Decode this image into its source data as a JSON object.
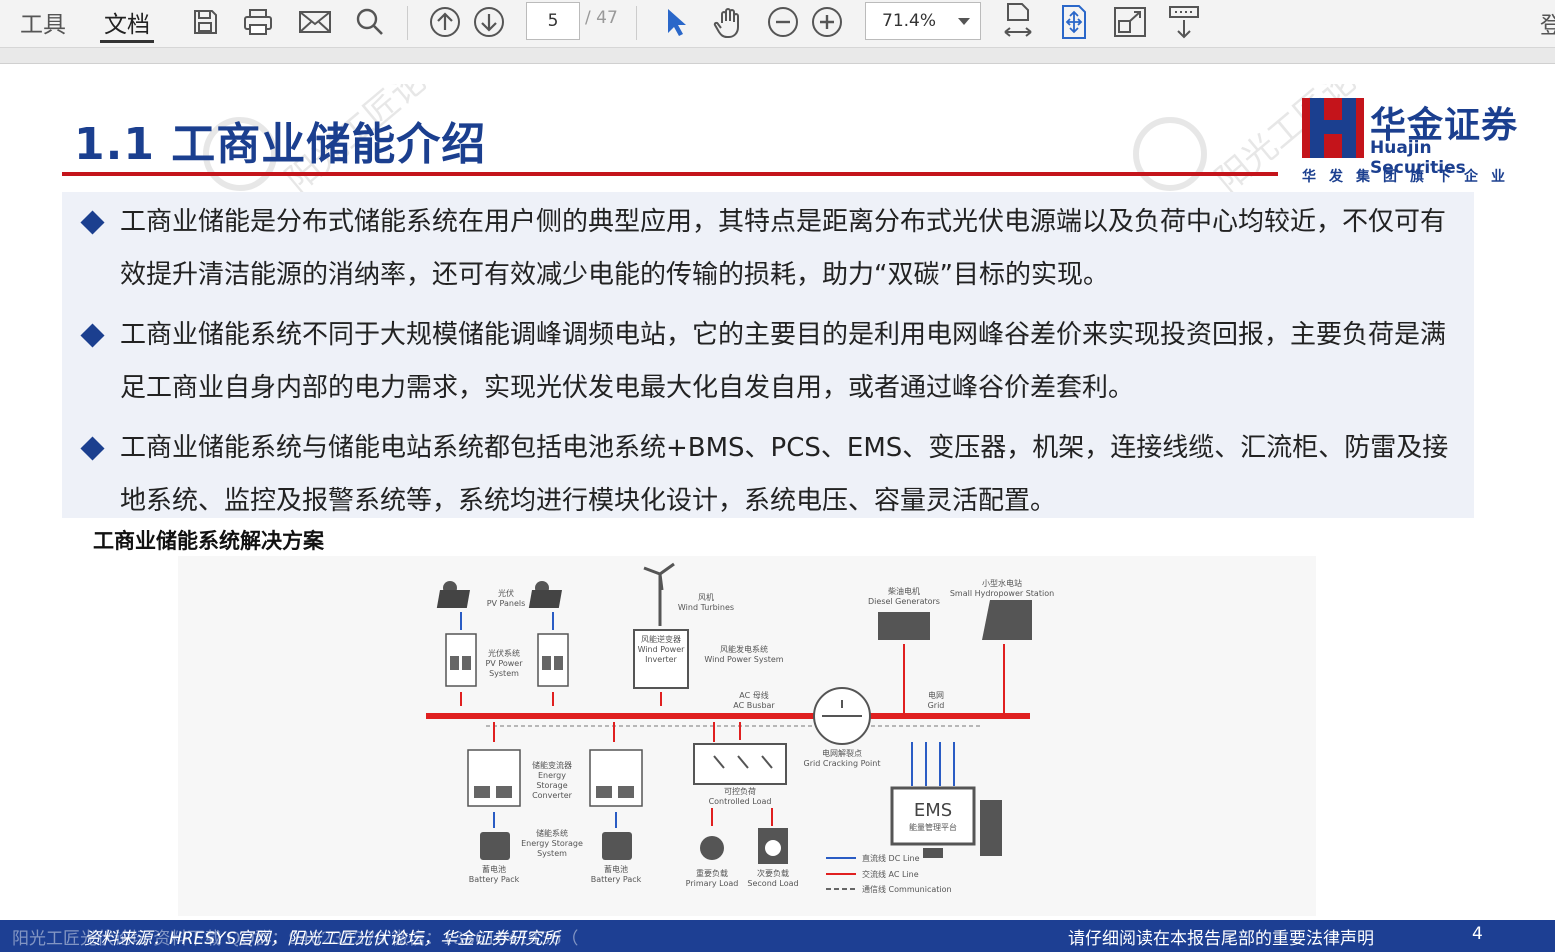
{
  "toolbar": {
    "tools_label": "工具",
    "document_label": "文档",
    "current_page": "5",
    "total_pages": "/ 47",
    "zoom_value": "71.4%",
    "right_label": "登"
  },
  "slide": {
    "title": "1.1 工商业储能介绍",
    "logo": {
      "name_cn": "华金证券",
      "name_en": "Huajin Securities",
      "subtitle": "华发集团旗下企业"
    },
    "bullets": [
      "工商业储能是分布式储能系统在用户侧的典型应用，其特点是距离分布式光伏电源端以及负荷中心均较近，不仅可有效提升清洁能源的消纳率，还可有效减少电能的传输的损耗，助力“双碳”目标的实现。",
      "工商业储能系统不同于大规模储能调峰调频电站，它的主要目的是利用电网峰谷差价来实现投资回报，主要负荷是满足工商业自身内部的电力需求，实现光伏发电最大化自发自用，或者通过峰谷价差套利。",
      "工商业储能系统与储能电站系统都包括电池系统+BMS、PCS、EMS、变压器，机架，连接线缆、汇流柜、防雷及接地系统、监控及报警系统等，系统均进行模块化设计，系统电压、容量灵活配置。"
    ],
    "figure_caption": "工商业储能系统解决方案",
    "diagram": {
      "pv_panels": [
        "光伏",
        "PV Panels"
      ],
      "pv_system": [
        "光伏系统",
        "PV Power",
        "System"
      ],
      "wind_turbines": [
        "风机",
        "Wind Turbines"
      ],
      "wind_inverter": [
        "风能逆变器",
        "Wind Power",
        "Inverter"
      ],
      "wind_system": [
        "风能发电系统",
        "Wind Power System"
      ],
      "diesel": [
        "柴油电机",
        "Diesel Generators"
      ],
      "hydro": [
        "小型水电站",
        "Small Hydropower Station"
      ],
      "ac_busbar": [
        "AC 母线",
        "AC Busbar"
      ],
      "grid": [
        "电网",
        "Grid"
      ],
      "grid_point": [
        "电网解裂点",
        "Grid Cracking Point"
      ],
      "converter": [
        "储能变流器",
        "Energy",
        "Storage",
        "Converter"
      ],
      "storage_system": [
        "储能系统",
        "Energy Storage",
        "System"
      ],
      "battery_pack": [
        "蓄电池",
        "Battery Pack"
      ],
      "controlled_load": [
        "可控负荷",
        "Controlled Load"
      ],
      "primary_load": [
        "重要负载",
        "Primary Load"
      ],
      "second_load": [
        "次要负载",
        "Second Load"
      ],
      "ems": "EMS",
      "ems_cn": "能量管理平台",
      "legend": [
        "直流线 DC Line",
        "交流线 AC Line",
        "通信线 Communication"
      ]
    }
  },
  "footer": {
    "source": "资料来源：HRESYS官网，阳光工匠光伏论坛，华金证券研究所",
    "disclaimer": "请仔细阅读在本报告尾部的重要法律声明",
    "page_number": "4",
    "watermark_text": "阳光工匠光伏论坛                                          资料下载    QQ群：940233279        微信：13861041436（"
  },
  "colors": {
    "brand_blue": "#1b3f8f",
    "accent_red": "#c4141b",
    "dc_line": "#2a5cc4",
    "ac_line": "#e02020"
  }
}
